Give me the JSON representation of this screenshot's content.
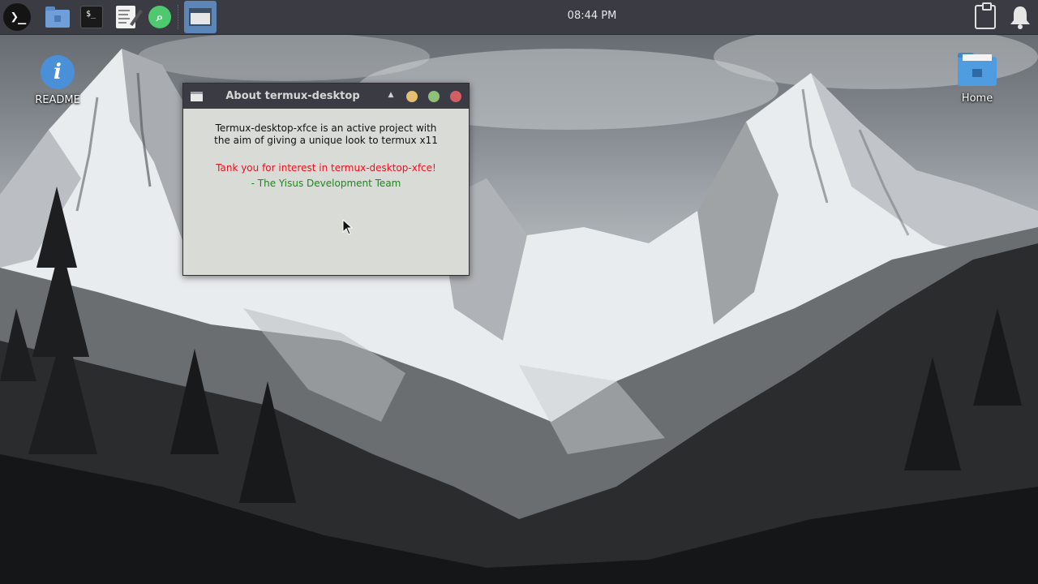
{
  "top_panel": {
    "launchers": [
      {
        "name": "terminal-logo",
        "icon": "terminal-prompt-icon"
      },
      {
        "name": "files",
        "icon": "folder-home-icon"
      },
      {
        "name": "terminal",
        "icon": "terminal-icon",
        "glyph": "$_"
      },
      {
        "name": "text-editor",
        "icon": "text-editor-icon"
      },
      {
        "name": "app-finder",
        "icon": "search-icon"
      }
    ],
    "active_window_icon": "window-icon",
    "clock": "08:44 PM",
    "tray": [
      "clipboard-icon",
      "bell-icon"
    ]
  },
  "desktop": {
    "icons": [
      {
        "label": "README",
        "icon": "info-icon",
        "glyph": "i"
      },
      {
        "label": "Home",
        "icon": "home-folder-icon"
      }
    ]
  },
  "dialog": {
    "title": "About termux-desktop",
    "menu_arrow": "▲",
    "line_1": "Termux-desktop-xfce is an active project with",
    "line_2": "the aim of giving a unique look to termux x11",
    "thanks": "Tank you for interest in termux-desktop-xfce!",
    "signature": "- The Yisus Development Team",
    "controls": {
      "minimize_color": "#e3bf71",
      "maximize_color": "#8fbf7a",
      "close_color": "#d35f63"
    },
    "thanks_color": "#e8141f",
    "signature_color": "#1b8a1b"
  },
  "colors": {
    "panel_bg": "#3b3b44",
    "dialog_bg": "#d8dbd6",
    "accent_blue": "#5c86b8"
  }
}
